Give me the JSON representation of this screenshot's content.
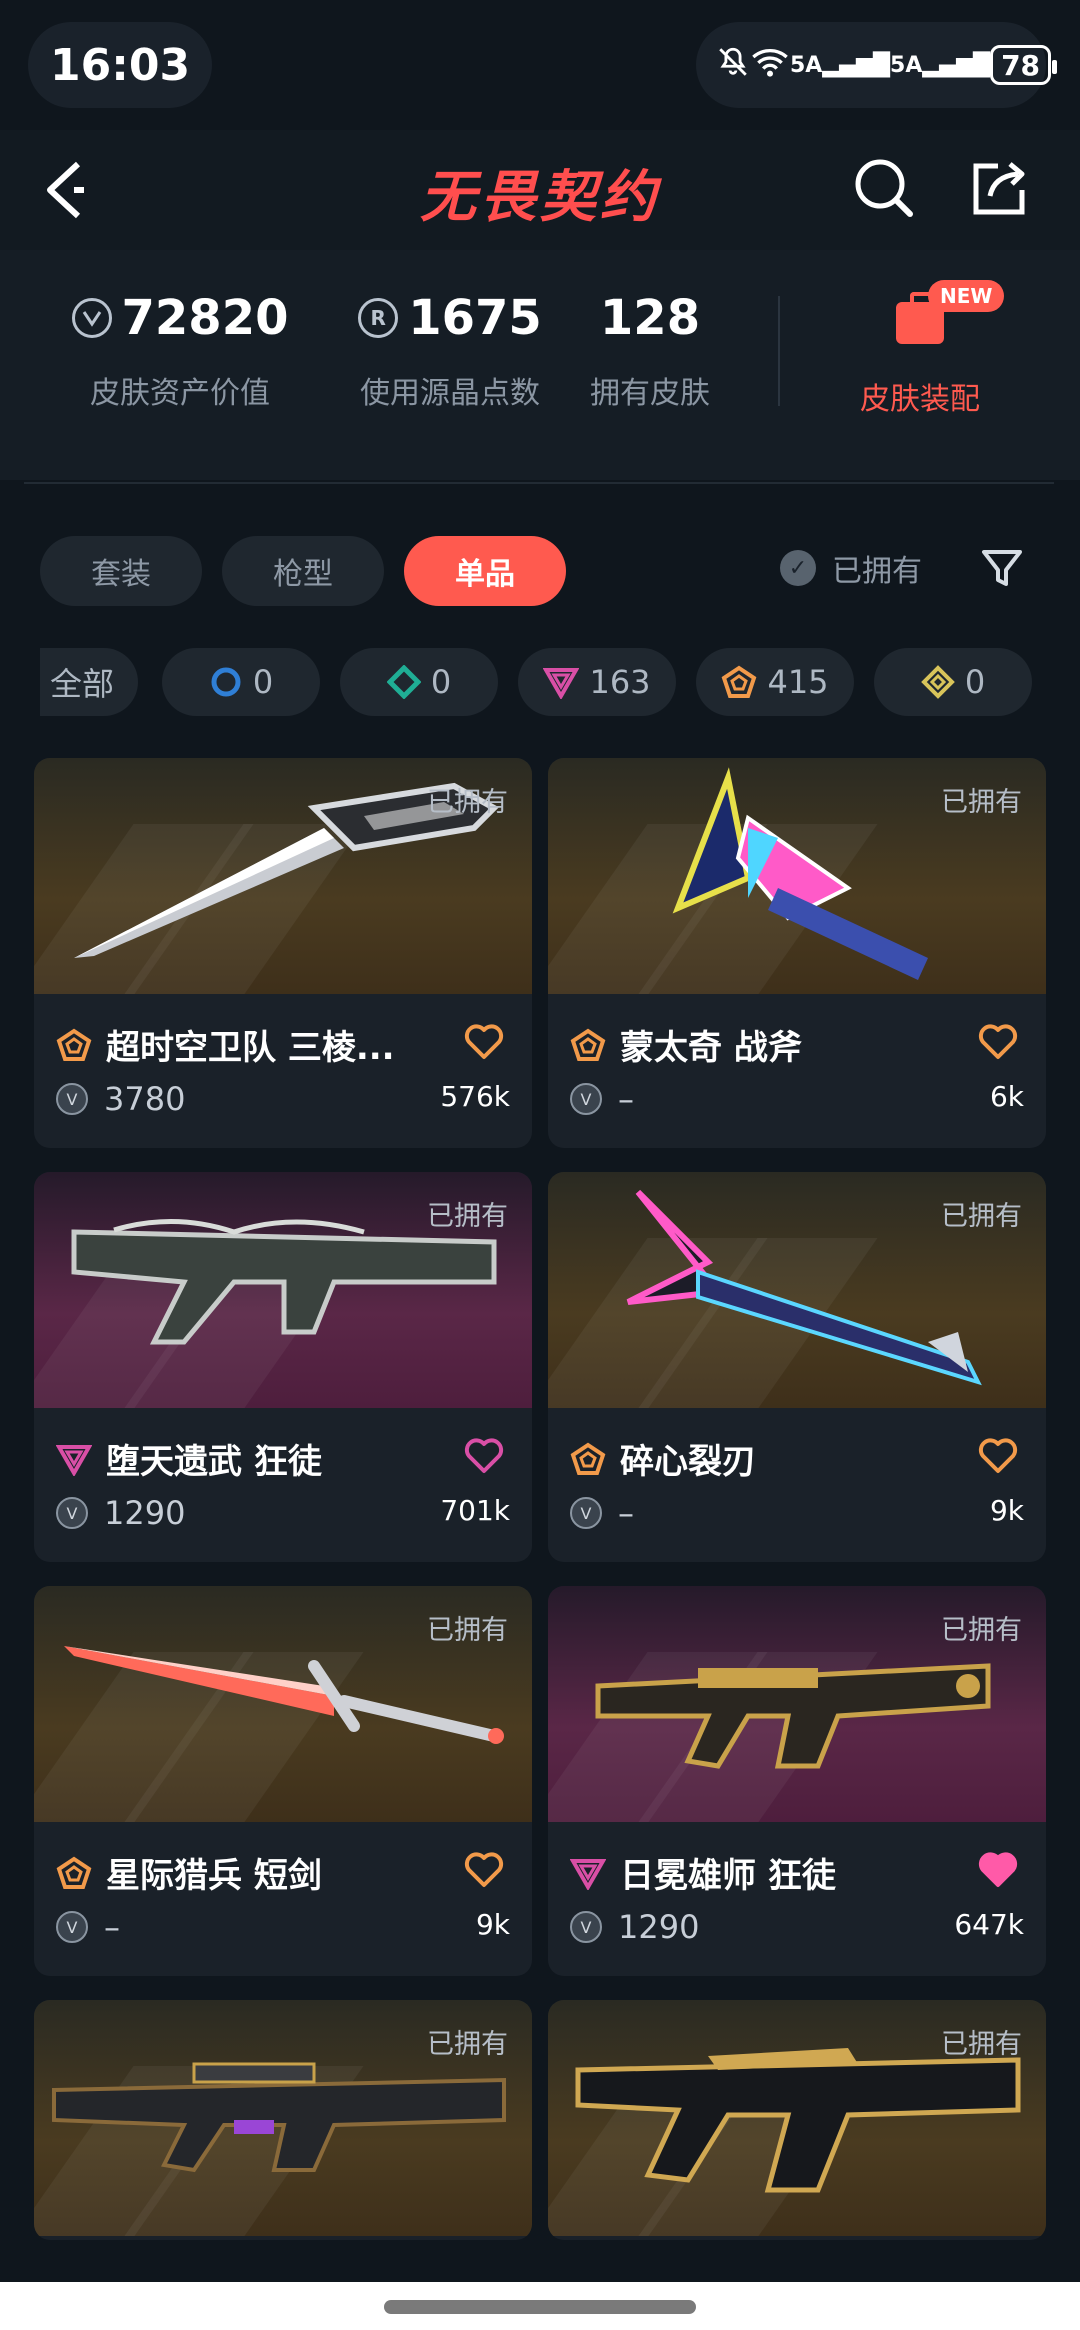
{
  "status_bar": {
    "time": "16:03",
    "signal_1": "5A",
    "signal_2": "5A",
    "battery": "78",
    "wifi_tag": "6"
  },
  "header": {
    "title": "无畏契约"
  },
  "stats": [
    {
      "icon": "V",
      "value": "72820",
      "label": "皮肤资产价值"
    },
    {
      "icon": "R",
      "value": "1675",
      "label": "使用源晶点数"
    },
    {
      "value": "128",
      "label": "拥有皮肤"
    }
  ],
  "loadout": {
    "label": "皮肤装配",
    "badge": "NEW"
  },
  "tabs": [
    {
      "label": "套装",
      "active": false
    },
    {
      "label": "枪型",
      "active": false
    },
    {
      "label": "单品",
      "active": true
    }
  ],
  "owned_filter": {
    "label": "已拥有",
    "check": "✓"
  },
  "chips": [
    {
      "label": "全部",
      "count": ""
    },
    {
      "label": "",
      "count": "0",
      "color": "#2f7fd6",
      "shape": "circle"
    },
    {
      "label": "",
      "count": "0",
      "color": "#1fae95",
      "shape": "diamond"
    },
    {
      "label": "",
      "count": "163",
      "color": "#d94fa6",
      "shape": "triangle"
    },
    {
      "label": "",
      "count": "415",
      "color": "#f29a4a",
      "shape": "pentagon"
    },
    {
      "label": "",
      "count": "0",
      "color": "#d8c45a",
      "shape": "diamond"
    }
  ],
  "cards": [
    {
      "owned": "已拥有",
      "name": "超时空卫队 三棱...",
      "price": "3780",
      "likes": "576k",
      "tier": "pentagon",
      "bg": "gold",
      "liked": false
    },
    {
      "owned": "已拥有",
      "name": "蒙太奇 战斧",
      "price": "–",
      "likes": "6k",
      "tier": "pentagon",
      "bg": "gold",
      "liked": false
    },
    {
      "owned": "已拥有",
      "name": "堕天遗武 狂徒",
      "price": "1290",
      "likes": "701k",
      "tier": "triangle",
      "bg": "purple",
      "liked": false
    },
    {
      "owned": "已拥有",
      "name": "碎心裂刃",
      "price": "–",
      "likes": "9k",
      "tier": "pentagon",
      "bg": "gold",
      "liked": false
    },
    {
      "owned": "已拥有",
      "name": "星际猎兵 短剑",
      "price": "–",
      "likes": "9k",
      "tier": "pentagon",
      "bg": "gold",
      "liked": false
    },
    {
      "owned": "已拥有",
      "name": "日冕雄师 狂徒",
      "price": "1290",
      "likes": "647k",
      "tier": "triangle",
      "bg": "purple",
      "liked": true
    },
    {
      "owned": "已拥有",
      "bg": "gold"
    },
    {
      "owned": "已拥有",
      "bg": "gold"
    }
  ],
  "colors": {
    "accent": "#ff5a4f",
    "background": "#0f161d",
    "card": "#1a2129",
    "tier_pentagon": "#f29a4a",
    "tier_triangle": "#d94fa6"
  }
}
